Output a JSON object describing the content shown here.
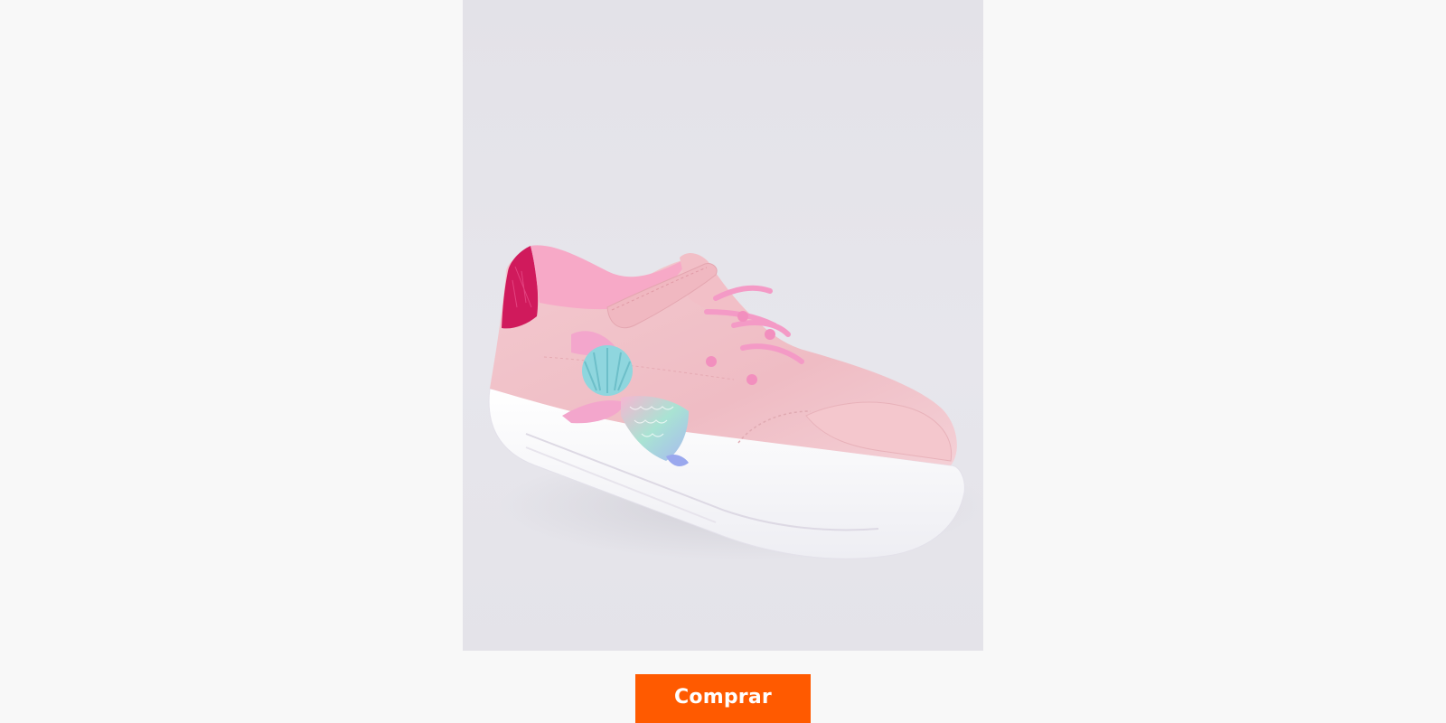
{
  "product": {
    "image_subject": "pink-kids-sneaker-with-mermaid-charm",
    "colors": {
      "background": "#f8f8f8",
      "photo_background": "#e5e4ea",
      "shoe_pink": "#f1c2c8",
      "heel_glitter": "#d11a5d",
      "sole": "#ffffff",
      "accent_charm": "#8fd6de"
    }
  },
  "actions": {
    "buy_label": "Comprar",
    "buy_color": "#ff5a00"
  }
}
